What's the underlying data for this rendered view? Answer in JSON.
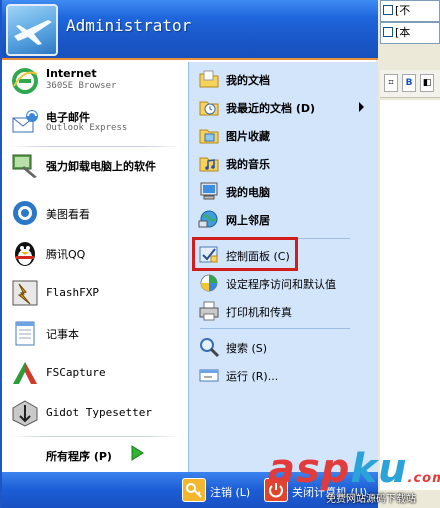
{
  "user": {
    "name": "Administrator"
  },
  "pinned": [
    {
      "name": "Internet",
      "sub": "360SE Browser",
      "icon": "ie-browser-icon"
    },
    {
      "name": "电子邮件",
      "sub": "Outlook Express",
      "icon": "outlook-express-icon"
    }
  ],
  "recent": [
    {
      "label": "强力卸载电脑上的软件",
      "icon": "uninstaller-icon",
      "bold": true
    },
    {
      "label": "美图看看",
      "icon": "meitu-viewer-icon"
    },
    {
      "label": "腾讯QQ",
      "icon": "qq-penguin-icon"
    },
    {
      "label": "FlashFXP",
      "icon": "flashfxp-icon"
    },
    {
      "label": "记事本",
      "icon": "notepad-icon"
    },
    {
      "label": "FSCapture",
      "icon": "fscapture-icon"
    },
    {
      "label": "Gidot Typesetter",
      "icon": "gidot-typesetter-icon"
    }
  ],
  "all_programs": {
    "label": "所有程序 (P)"
  },
  "places": [
    {
      "label": "我的文档",
      "icon": "my-documents-icon"
    },
    {
      "label": "我最近的文档 (D)",
      "icon": "recent-documents-icon"
    },
    {
      "label": "图片收藏",
      "icon": "my-pictures-icon"
    },
    {
      "label": "我的音乐",
      "icon": "my-music-icon"
    },
    {
      "label": "我的电脑",
      "icon": "my-computer-icon"
    },
    {
      "label": "网上邻居",
      "icon": "network-places-icon"
    }
  ],
  "system": [
    {
      "label": "控制面板 (C)",
      "icon": "control-panel-icon"
    },
    {
      "label": "设定程序访问和默认值",
      "icon": "program-access-icon"
    },
    {
      "label": "打印机和传真",
      "icon": "printers-icon"
    }
  ],
  "tools": [
    {
      "label": "搜索 (S)",
      "icon": "search-icon"
    },
    {
      "label": "运行 (R)...",
      "icon": "run-icon"
    }
  ],
  "footer": {
    "logoff": "注销 (L)",
    "shutdown": "关闭计算机 (U)"
  },
  "bg_window": {
    "row1": "[不",
    "row2": "[本"
  },
  "watermark": {
    "logo_a": "asp",
    "logo_b": "ku",
    "suffix": ".com",
    "sub": "免费网站源码下载站"
  },
  "colors": {
    "highlight": "#d21d1d",
    "header_blue": "#1f66dc",
    "places_bg": "#d3e5fa",
    "orange_edge": "#e8903a"
  }
}
